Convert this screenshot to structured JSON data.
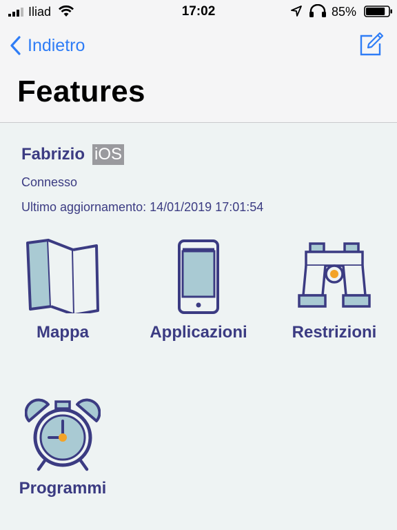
{
  "status_bar": {
    "carrier": "Iliad",
    "time": "17:02",
    "battery_percent": "85%",
    "battery_level": 0.85,
    "signal_icon": "signal-bars-icon",
    "wifi_icon": "wifi-icon"
  },
  "nav": {
    "back_label": "Indietro",
    "title": "Features",
    "accent_color": "#2f7df6"
  },
  "device": {
    "name": "Fabrizio",
    "os": "iOS",
    "status": "Connesso",
    "last_update": "Ultimo aggiornamento: 14/01/2019 17:01:54"
  },
  "features": [
    {
      "label": "Mappa",
      "icon": "map-icon"
    },
    {
      "label": "Applicazioni",
      "icon": "smartphone-icon"
    },
    {
      "label": "Restrizioni",
      "icon": "binoculars-icon"
    },
    {
      "label": "Programmi",
      "icon": "alarm-clock-icon"
    }
  ],
  "colors": {
    "icon_stroke": "#3b3b82",
    "icon_fill": "#a9cad3",
    "icon_accent": "#f3a327",
    "text": "#3b3b82"
  }
}
